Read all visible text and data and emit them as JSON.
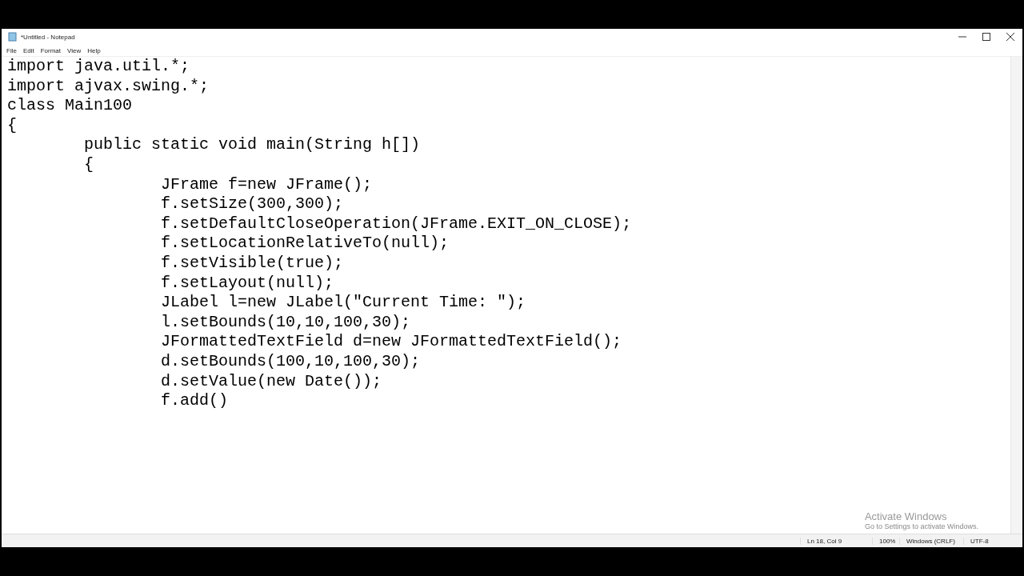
{
  "window": {
    "title": "*Untitled - Notepad"
  },
  "menu": [
    "File",
    "Edit",
    "Format",
    "View",
    "Help"
  ],
  "editor": {
    "lines": [
      "import java.util.*;",
      "import ajvax.swing.*;",
      "class Main100",
      "{",
      "\tpublic static void main(String h[])",
      "\t{",
      "\t\tJFrame f=new JFrame();",
      "\t\tf.setSize(300,300);",
      "\t\tf.setDefaultCloseOperation(JFrame.EXIT_ON_CLOSE);",
      "\t\tf.setLocationRelativeTo(null);",
      "\t\tf.setVisible(true);",
      "\t\tf.setLayout(null);",
      "\t\tJLabel l=new JLabel(\"Current Time: \");",
      "\t\tl.setBounds(10,10,100,30);",
      "\t\tJFormattedTextField d=new JFormattedTextField();",
      "\t\td.setBounds(100,10,100,30);",
      "\t\td.setValue(new Date());",
      "\t\tf.add()"
    ]
  },
  "activation": {
    "title": "Activate Windows",
    "subtitle": "Go to Settings to activate Windows."
  },
  "status_bar": [
    "Ln 18, Col 9",
    "100%",
    "Windows (CRLF)",
    "UTF-8"
  ]
}
